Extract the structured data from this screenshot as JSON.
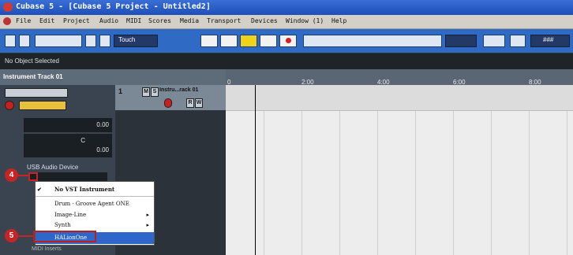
{
  "window": {
    "title": "Cubase 5 - [Cubase 5 Project - Untitled2]"
  },
  "menubar": {
    "items": [
      "File",
      "Edit",
      "Project",
      "Audio",
      "MIDI",
      "Scores",
      "Media",
      "Transport",
      "Devices",
      "Window (1)",
      "Help"
    ]
  },
  "toolbar": {
    "automation_mode": "Touch",
    "snap_value": "###"
  },
  "infoline": {
    "text": "No Object Selected"
  },
  "inspector": {
    "track_name": "Instrument Track 01",
    "volume_value": "0.00",
    "pan_value": "C",
    "delay_value": "0.00",
    "output_device": "USB Audio Device",
    "midi_inserts_label": "MIDI Inserts"
  },
  "tracklist": {
    "track_number": "1",
    "track_name": "Instru...rack 01",
    "mute_label": "M",
    "solo_label": "S",
    "read_label": "R",
    "write_label": "W"
  },
  "ruler": {
    "ticks": [
      "2:00",
      "4:00",
      "6:00",
      "8:00"
    ],
    "start_label": "0"
  },
  "popup_menu": {
    "items": [
      {
        "label": "No VST Instrument",
        "checked": true,
        "submenu": false
      },
      {
        "label": "Drum - Groove Agent ONE",
        "checked": false,
        "submenu": false
      },
      {
        "label": "Image-Line",
        "checked": false,
        "submenu": true
      },
      {
        "label": "Synth",
        "checked": false,
        "submenu": true
      },
      {
        "label": "HALionOne",
        "checked": false,
        "submenu": false,
        "highlighted": true
      }
    ]
  },
  "annotations": {
    "step4": "4",
    "step5": "5",
    "color": "#c62424"
  }
}
